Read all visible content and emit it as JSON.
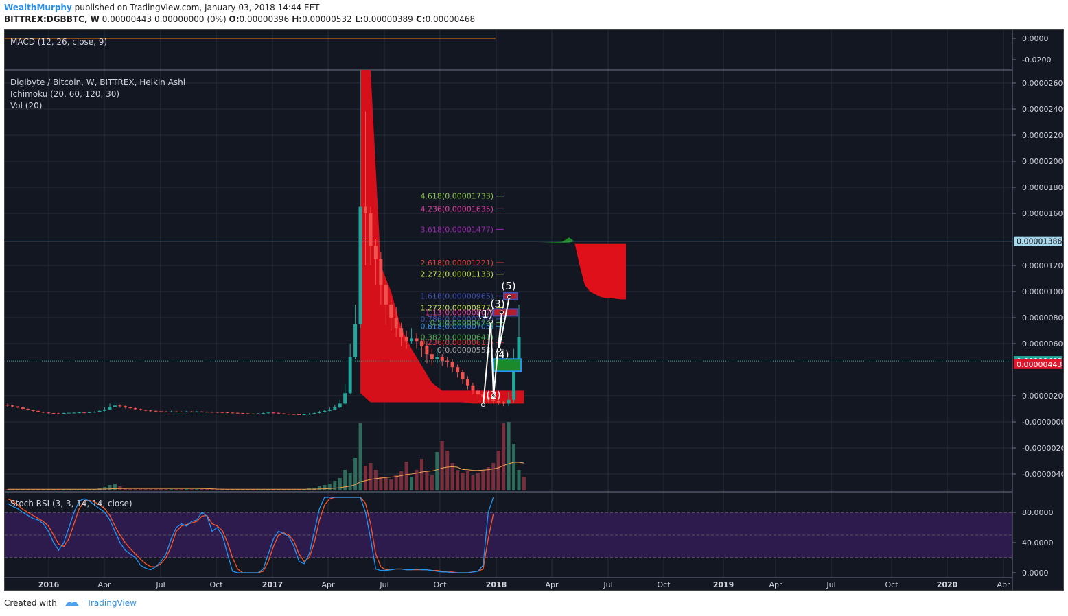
{
  "header": {
    "author": "WealthMurphy",
    "published": " published on TradingView.com, January 03, 2018 14:44 EET",
    "symbol": "BITTREX:DGBBTC, W",
    "quote": " 0.00000443 0.00000000 (0%) ",
    "o_label": "O:",
    "o_val": "0.00000396",
    "h_label": " H:",
    "h_val": "0.00000532",
    "l_label": " L:",
    "l_val": "0.00000389",
    "c_label": " C:",
    "c_val": "0.00000468"
  },
  "footer": {
    "created_with": "Created with",
    "brand": "TradingView"
  },
  "chart_data": {
    "type": "candlestick",
    "panes": {
      "macd": {
        "label": "MACD (12, 26, close, 9)",
        "axis_ticks": [
          "0.0000",
          "-0.0200"
        ]
      },
      "price": {
        "title": "Digibyte / Bitcoin, W, BITTREX, Heikin Ashi",
        "indicators": [
          "Ichimoku (20, 60, 120, 30)",
          "Vol (20)"
        ],
        "axis_ticks": [
          "0.00002600",
          "0.00002400",
          "0.00002200",
          "0.00002000",
          "0.00001800",
          "0.00001600",
          "0.00001200",
          "0.00001000",
          "0.00000800",
          "0.00000600",
          "0.00000200",
          "-0.00000000",
          "-0.00000200",
          "-0.00000400"
        ],
        "axis_tick_values": [
          2600,
          2400,
          2200,
          2000,
          1800,
          1600,
          1200,
          1000,
          800,
          600,
          200,
          0,
          -200,
          -400
        ],
        "price_tags": [
          {
            "label": "0.00001386",
            "value": 1386,
            "color": "#a8d8ea",
            "text": "#131722"
          },
          {
            "label": "0.00000468",
            "value": 468,
            "color": "#26a69a",
            "text": "#ffffff"
          },
          {
            "label": "0.00000443",
            "value": 443,
            "color": "#e0162b",
            "text": "#ffffff"
          }
        ],
        "unit": "satoshi"
      },
      "stoch": {
        "label": "Stoch RSI (3, 3, 14, 14, close)",
        "axis_ticks": [
          "80.0000",
          "40.0000",
          "0.0000"
        ],
        "axis_tick_values": [
          80,
          40,
          0
        ]
      }
    },
    "x_labels": [
      "2016",
      "Apr",
      "Jul",
      "Oct",
      "2017",
      "Apr",
      "Jul",
      "Oct",
      "2018",
      "Apr",
      "Jul",
      "Oct",
      "2019",
      "Apr",
      "Jul",
      "Oct",
      "2020",
      "Apr"
    ],
    "candles": [
      [
        130,
        125,
        140,
        115
      ],
      [
        125,
        118,
        128,
        112
      ],
      [
        118,
        110,
        120,
        105
      ],
      [
        110,
        100,
        112,
        95
      ],
      [
        100,
        92,
        103,
        88
      ],
      [
        92,
        85,
        95,
        80
      ],
      [
        85,
        78,
        88,
        75
      ],
      [
        78,
        72,
        80,
        68
      ],
      [
        72,
        68,
        74,
        64
      ],
      [
        68,
        66,
        70,
        62
      ],
      [
        66,
        65,
        69,
        60
      ],
      [
        65,
        68,
        72,
        62
      ],
      [
        68,
        70,
        74,
        64
      ],
      [
        70,
        71,
        76,
        66
      ],
      [
        71,
        73,
        78,
        68
      ],
      [
        73,
        72,
        76,
        68
      ],
      [
        72,
        74,
        80,
        68
      ],
      [
        74,
        78,
        82,
        70
      ],
      [
        78,
        85,
        92,
        75
      ],
      [
        85,
        95,
        110,
        82
      ],
      [
        95,
        115,
        140,
        90
      ],
      [
        115,
        125,
        150,
        110
      ],
      [
        125,
        120,
        135,
        108
      ],
      [
        120,
        112,
        125,
        104
      ],
      [
        112,
        105,
        118,
        98
      ],
      [
        105,
        98,
        110,
        92
      ],
      [
        98,
        92,
        102,
        86
      ],
      [
        92,
        88,
        95,
        82
      ],
      [
        88,
        85,
        92,
        80
      ],
      [
        85,
        82,
        88,
        78
      ],
      [
        82,
        80,
        86,
        76
      ],
      [
        80,
        78,
        84,
        74
      ],
      [
        78,
        80,
        85,
        74
      ],
      [
        80,
        79,
        84,
        75
      ],
      [
        79,
        78,
        82,
        74
      ],
      [
        78,
        80,
        85,
        74
      ],
      [
        80,
        79,
        84,
        76
      ],
      [
        79,
        80,
        84,
        76
      ],
      [
        80,
        78,
        83,
        75
      ],
      [
        78,
        77,
        81,
        74
      ],
      [
        77,
        76,
        80,
        72
      ],
      [
        76,
        75,
        79,
        72
      ],
      [
        75,
        74,
        78,
        71
      ],
      [
        74,
        72,
        76,
        68
      ],
      [
        72,
        70,
        74,
        66
      ],
      [
        70,
        68,
        72,
        64
      ],
      [
        68,
        66,
        70,
        62
      ],
      [
        66,
        64,
        68,
        60
      ],
      [
        64,
        63,
        66,
        60
      ],
      [
        63,
        65,
        68,
        60
      ],
      [
        65,
        68,
        72,
        62
      ],
      [
        68,
        72,
        76,
        64
      ],
      [
        72,
        70,
        74,
        66
      ],
      [
        70,
        65,
        72,
        62
      ],
      [
        65,
        62,
        68,
        58
      ],
      [
        62,
        60,
        64,
        56
      ],
      [
        60,
        58,
        62,
        54
      ],
      [
        58,
        56,
        60,
        52
      ],
      [
        56,
        58,
        62,
        52
      ],
      [
        58,
        62,
        68,
        55
      ],
      [
        62,
        68,
        75,
        60
      ],
      [
        68,
        75,
        85,
        65
      ],
      [
        75,
        85,
        95,
        72
      ],
      [
        85,
        95,
        110,
        82
      ],
      [
        95,
        110,
        130,
        92
      ],
      [
        110,
        140,
        170,
        105
      ],
      [
        140,
        220,
        290,
        135
      ],
      [
        220,
        500,
        600,
        210
      ],
      [
        500,
        750,
        900,
        480
      ],
      [
        750,
        1650,
        2700,
        720
      ],
      [
        1650,
        1600,
        2380,
        1200
      ],
      [
        1600,
        1350,
        1650,
        1200
      ],
      [
        1350,
        1250,
        1400,
        1050
      ],
      [
        1250,
        1050,
        1300,
        900
      ],
      [
        1050,
        900,
        1100,
        750
      ],
      [
        900,
        800,
        950,
        700
      ],
      [
        800,
        720,
        880,
        650
      ],
      [
        720,
        650,
        760,
        580
      ],
      [
        650,
        620,
        700,
        560
      ],
      [
        620,
        640,
        720,
        600
      ],
      [
        640,
        620,
        680,
        560
      ],
      [
        620,
        580,
        640,
        500
      ],
      [
        580,
        520,
        620,
        450
      ],
      [
        520,
        480,
        560,
        430
      ],
      [
        480,
        500,
        560,
        450
      ],
      [
        500,
        470,
        520,
        430
      ],
      [
        470,
        460,
        500,
        420
      ],
      [
        460,
        420,
        480,
        380
      ],
      [
        420,
        380,
        440,
        340
      ],
      [
        380,
        330,
        400,
        290
      ],
      [
        330,
        280,
        350,
        250
      ],
      [
        280,
        240,
        300,
        210
      ],
      [
        240,
        210,
        260,
        180
      ],
      [
        210,
        190,
        230,
        160
      ],
      [
        190,
        170,
        210,
        150
      ],
      [
        170,
        160,
        185,
        140
      ],
      [
        160,
        150,
        170,
        130
      ],
      [
        150,
        140,
        160,
        120
      ],
      [
        140,
        170,
        230,
        120
      ],
      [
        170,
        460,
        560,
        150
      ],
      [
        460,
        650,
        900,
        400
      ]
    ],
    "volume": [
      0.02,
      0.02,
      0.02,
      0.02,
      0.02,
      0.02,
      0.02,
      0.02,
      0.02,
      0.02,
      0.02,
      0.02,
      0.02,
      0.02,
      0.02,
      0.02,
      0.02,
      0.02,
      0.03,
      0.05,
      0.08,
      0.1,
      0.06,
      0.03,
      0.02,
      0.02,
      0.02,
      0.02,
      0.02,
      0.02,
      0.02,
      0.02,
      0.02,
      0.02,
      0.02,
      0.02,
      0.02,
      0.02,
      0.02,
      0.02,
      0.02,
      0.02,
      0.02,
      0.02,
      0.02,
      0.02,
      0.02,
      0.02,
      0.02,
      0.02,
      0.02,
      0.02,
      0.02,
      0.02,
      0.02,
      0.02,
      0.02,
      0.02,
      0.02,
      0.03,
      0.04,
      0.06,
      0.08,
      0.1,
      0.14,
      0.18,
      0.3,
      0.26,
      0.48,
      0.98,
      0.36,
      0.4,
      0.3,
      0.2,
      0.18,
      0.16,
      0.22,
      0.28,
      0.42,
      0.2,
      0.3,
      0.46,
      0.28,
      0.22,
      0.56,
      0.72,
      0.58,
      0.4,
      0.3,
      0.26,
      0.28,
      0.22,
      0.26,
      0.3,
      0.34,
      0.4,
      0.58,
      0.98,
      1.0,
      0.68,
      0.3,
      0.2
    ],
    "fib_levels": [
      {
        "label": "4.618(0.00001733)",
        "value": 1733,
        "color": "#8bc34a"
      },
      {
        "label": "4.236(0.00001635)",
        "value": 1635,
        "color": "#e040a0"
      },
      {
        "label": "3.618(0.00001477)",
        "value": 1477,
        "color": "#9c27b0"
      },
      {
        "label": "2.618(0.00001221)",
        "value": 1221,
        "color": "#e53935"
      },
      {
        "label": "2.272(0.00001133)",
        "value": 1133,
        "color": "#c6e04a"
      },
      {
        "label": "1.618(0.00000965)",
        "value": 965,
        "color": "#3f51b5"
      },
      {
        "label": "1.272(0.00000877)",
        "value": 877,
        "color": "#c6e04a"
      },
      {
        "label": "1.13(0.00000807)",
        "value": 840,
        "color": "#e040a0"
      },
      {
        "label": "0.786(0.00000720)",
        "value": 790,
        "color": "#3f51b5"
      },
      {
        "label": "0.618(0.00000705)",
        "value": 735,
        "color": "#2e8fe6"
      },
      {
        "label": "0.5(0.00000674)",
        "value": 760,
        "color": "#4caf50"
      },
      {
        "label": "0.382(0.00000641)",
        "value": 650,
        "color": "#4caf50"
      },
      {
        "label": "0.236(0.00000613)",
        "value": 610,
        "color": "#e53935"
      },
      {
        "label": "0(0.00000553)",
        "value": 553,
        "color": "#9e9e9e"
      }
    ],
    "wave_labels": [
      "(1)",
      "(2)",
      "(3)",
      "(4)",
      "(5)"
    ],
    "colors": {
      "bull": "#26a69a",
      "bear": "#ef5350",
      "cloud": "#e0101a",
      "volume_ma": "#f0a050",
      "stoch_k": "#2196f3",
      "stoch_d": "#ff5722",
      "stoch_band": "#2d1b4e"
    },
    "stoch_k": [
      92,
      88,
      85,
      80,
      76,
      72,
      70,
      65,
      55,
      40,
      30,
      40,
      60,
      80,
      95,
      98,
      95,
      90,
      85,
      80,
      70,
      55,
      40,
      30,
      25,
      20,
      10,
      6,
      4,
      8,
      15,
      25,
      45,
      60,
      65,
      62,
      68,
      70,
      80,
      75,
      55,
      60,
      50,
      25,
      2,
      0,
      0,
      0,
      0,
      0,
      5,
      25,
      45,
      55,
      52,
      48,
      35,
      15,
      12,
      25,
      55,
      85,
      100,
      100,
      100,
      100,
      100,
      100,
      100,
      100,
      80,
      45,
      5,
      3,
      3,
      4,
      5,
      5,
      4,
      4,
      5,
      4,
      4,
      3,
      2,
      1,
      1,
      0,
      0,
      0,
      0,
      1,
      2,
      10,
      80,
      100
    ],
    "stoch_d": [
      98,
      95,
      90,
      84,
      80,
      76,
      72,
      68,
      62,
      50,
      38,
      35,
      45,
      65,
      85,
      95,
      96,
      94,
      90,
      85,
      76,
      62,
      50,
      40,
      32,
      25,
      18,
      12,
      8,
      8,
      12,
      20,
      35,
      55,
      62,
      64,
      66,
      68,
      75,
      76,
      65,
      62,
      56,
      40,
      20,
      5,
      0,
      0,
      0,
      0,
      2,
      15,
      35,
      50,
      53,
      50,
      42,
      25,
      15,
      20,
      40,
      70,
      90,
      98,
      100,
      100,
      100,
      100,
      100,
      100,
      92,
      65,
      25,
      8,
      4,
      4,
      5,
      5,
      4,
      4,
      4,
      4,
      4,
      3,
      3,
      2,
      1,
      1,
      0,
      0,
      0,
      1,
      2,
      5,
      45,
      78
    ],
    "cloud_top": [
      2700,
      2700,
      1200,
      1000,
      720,
      560,
      430,
      300,
      240,
      240,
      240,
      240,
      240,
      240,
      240,
      240,
      240
    ],
    "cloud_bottom": [
      220,
      150,
      150,
      150,
      150,
      150,
      150,
      150,
      150,
      150,
      150,
      140,
      140,
      140,
      140,
      140,
      140
    ],
    "future_cloud_top": [
      1370,
      1370,
      1370,
      1370,
      1370,
      1370,
      1370,
      1370,
      1370,
      1370,
      1370
    ],
    "future_cloud_bottom": [
      1380,
      1200,
      1050,
      1000,
      980,
      960,
      950,
      950,
      945,
      940,
      940
    ]
  }
}
